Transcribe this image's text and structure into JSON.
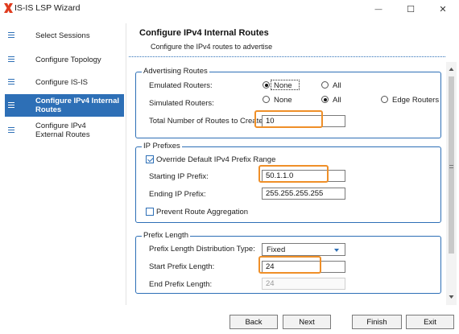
{
  "window": {
    "title": "IS-IS LSP Wizard",
    "minimize_glyph": "—",
    "maximize_glyph": "☐",
    "close_glyph": "✕"
  },
  "nav": {
    "items": [
      {
        "label": "Select Sessions",
        "active": false
      },
      {
        "label": "Configure Topology",
        "active": false
      },
      {
        "label": "Configure IS-IS",
        "active": false
      },
      {
        "label": "Configure IPv4 Internal Routes",
        "active": true
      },
      {
        "label": "Configure IPv4 External Routes",
        "active": false
      }
    ]
  },
  "header": {
    "title": "Configure IPv4 Internal Routes",
    "subtitle": "Configure the IPv4 routes to advertise"
  },
  "advertising_routes": {
    "legend": "Advertising Routes",
    "emulated_label": "Emulated Routers:",
    "emulated_options": [
      "None",
      "All"
    ],
    "emulated_selected": "None",
    "simulated_label": "Simulated Routers:",
    "simulated_options": [
      "None",
      "All",
      "Edge Routers"
    ],
    "simulated_selected": "All",
    "total_label": "Total Number of Routes to Create:",
    "total_value": "10"
  },
  "ip_prefixes": {
    "legend": "IP Prefixes",
    "override_label": "Override Default IPv4 Prefix Range",
    "override_checked": true,
    "start_label": "Starting IP Prefix:",
    "start_value": "50.1.1.0",
    "end_label": "Ending IP Prefix:",
    "end_value": "255.255.255.255",
    "prevent_label": "Prevent Route Aggregation",
    "prevent_checked": false
  },
  "prefix_length": {
    "legend": "Prefix Length",
    "dist_label": "Prefix Length Distribution Type:",
    "dist_value": "Fixed",
    "start_label": "Start Prefix Length:",
    "start_value": "24",
    "end_label": "End Prefix Length:",
    "end_value": "24"
  },
  "footer": {
    "back": "Back",
    "next": "Next",
    "finish": "Finish",
    "exit": "Exit"
  },
  "colors": {
    "accent": "#2d6fb6",
    "highlight": "#ef8f28"
  }
}
